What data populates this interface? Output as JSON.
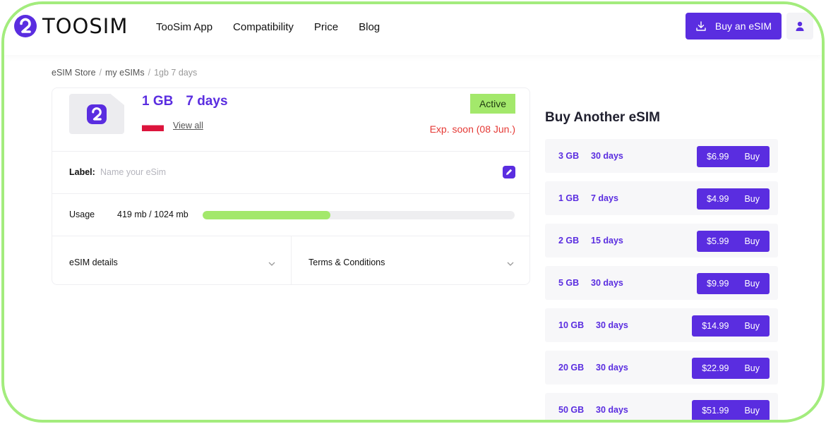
{
  "brand": {
    "name": "TOOSIM"
  },
  "nav": [
    {
      "label": "TooSim App"
    },
    {
      "label": "Compatibility"
    },
    {
      "label": "Price"
    },
    {
      "label": "Blog"
    }
  ],
  "header": {
    "buy_label": "Buy an eSIM"
  },
  "breadcrumb": {
    "items": [
      "eSIM Store",
      "my eSIMs",
      "1gb 7 days"
    ]
  },
  "esim": {
    "data": "1 GB",
    "duration": "7 days",
    "view_all": "View all",
    "status": "Active",
    "expiry": "Exp. soon (08 Jun.)",
    "label_title": "Label:",
    "label_placeholder": "Name your eSim",
    "usage_title": "Usage",
    "usage_text": "419 mb / 1024 mb",
    "usage_fraction": 0.409,
    "details_label": "eSIM details",
    "terms_label": "Terms & Conditions"
  },
  "side": {
    "title": "Buy Another eSIM",
    "plans": [
      {
        "data": "3 GB",
        "days": "30 days",
        "price": "$6.99",
        "buy": "Buy"
      },
      {
        "data": "1 GB",
        "days": "7 days",
        "price": "$4.99",
        "buy": "Buy"
      },
      {
        "data": "2 GB",
        "days": "15 days",
        "price": "$5.99",
        "buy": "Buy"
      },
      {
        "data": "5 GB",
        "days": "30 days",
        "price": "$9.99",
        "buy": "Buy"
      },
      {
        "data": "10 GB",
        "days": "30 days",
        "price": "$14.99",
        "buy": "Buy"
      },
      {
        "data": "20 GB",
        "days": "30 days",
        "price": "$22.99",
        "buy": "Buy"
      },
      {
        "data": "50 GB",
        "days": "30 days",
        "price": "$51.99",
        "buy": "Buy"
      }
    ]
  },
  "colors": {
    "accent": "#5a2de0",
    "active": "#a3e86b",
    "expiry": "#e53935",
    "frame": "#a3ec7d"
  }
}
